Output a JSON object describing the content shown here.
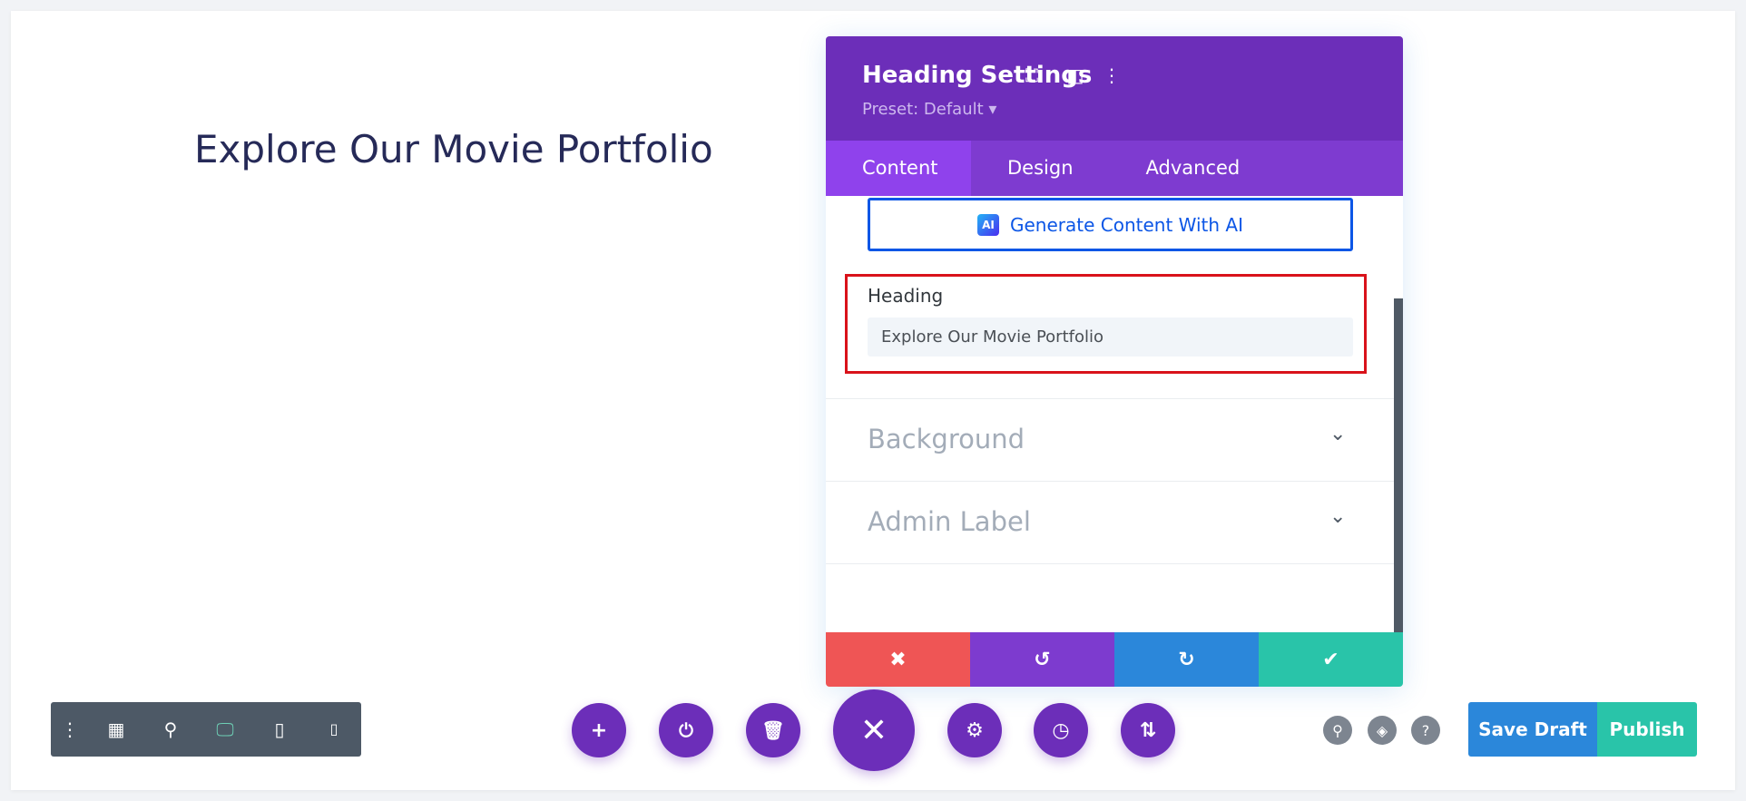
{
  "page": {
    "heading": "Explore Our Movie Portfolio"
  },
  "panel": {
    "title": "Heading Settings",
    "preset": "Preset: Default ▾",
    "tabs": [
      {
        "label": "Content"
      },
      {
        "label": "Design"
      },
      {
        "label": "Advanced"
      }
    ],
    "ai_button": "Generate Content With AI",
    "ai_badge": "AI",
    "heading_label": "Heading",
    "heading_value": "Explore Our Movie Portfolio",
    "sections": [
      {
        "label": "Background"
      },
      {
        "label": "Admin Label"
      }
    ],
    "footer_colors": {
      "cancel": "#ef5555",
      "undo": "#7d3bcf",
      "redo": "#2b87da",
      "save": "#29c4a9"
    }
  },
  "bottom": {
    "save_draft": "Save Draft",
    "publish": "Publish"
  },
  "colors": {
    "accent": "#6c2eb9",
    "highlight": "#d9121a"
  }
}
